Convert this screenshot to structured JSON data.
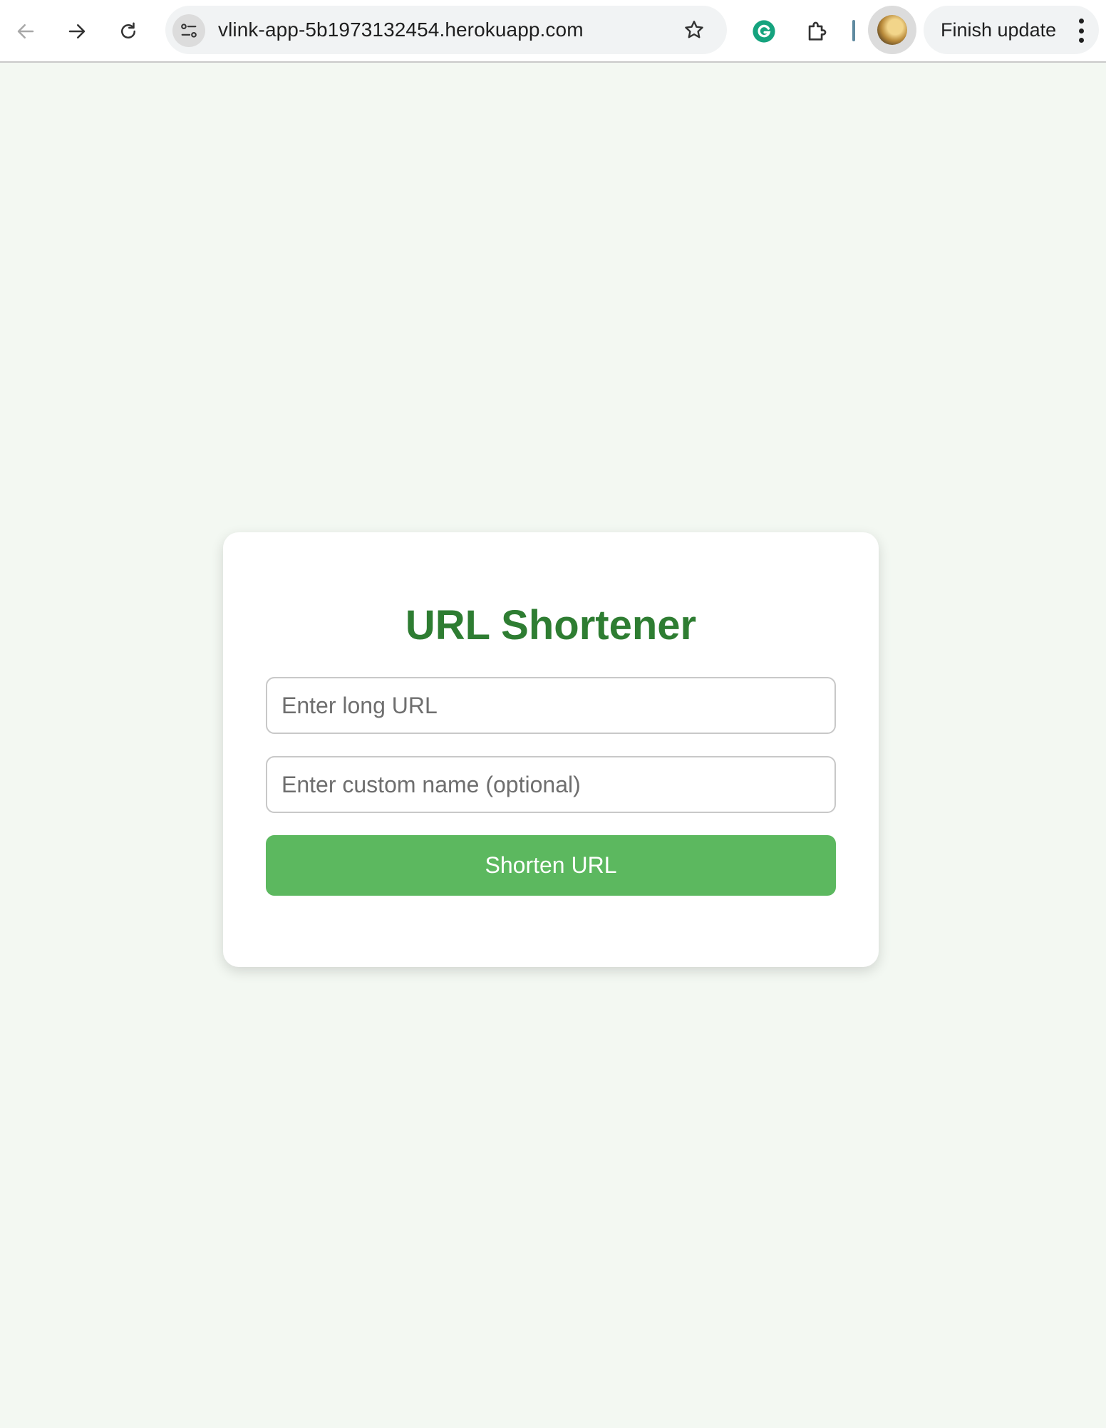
{
  "browser": {
    "url": "vlink-app-5b1973132454.herokuapp.com",
    "update_button_label": "Finish update",
    "icons": [
      "back-icon",
      "forward-icon",
      "reload-icon",
      "site-info-icon",
      "bookmark-star-icon",
      "grammarly-icon",
      "extensions-icon",
      "profile-avatar",
      "more-menu-icon"
    ]
  },
  "card": {
    "title": "URL Shortener",
    "long_url_placeholder": "Enter long URL",
    "long_url_value": "",
    "custom_name_placeholder": "Enter custom name (optional)",
    "custom_name_value": "",
    "submit_label": "Shorten URL"
  },
  "colors": {
    "page_background": "#f3f8f2",
    "title_green": "#2e7d32",
    "button_green": "#5cb85f",
    "grammarly_green": "#15a37e"
  }
}
